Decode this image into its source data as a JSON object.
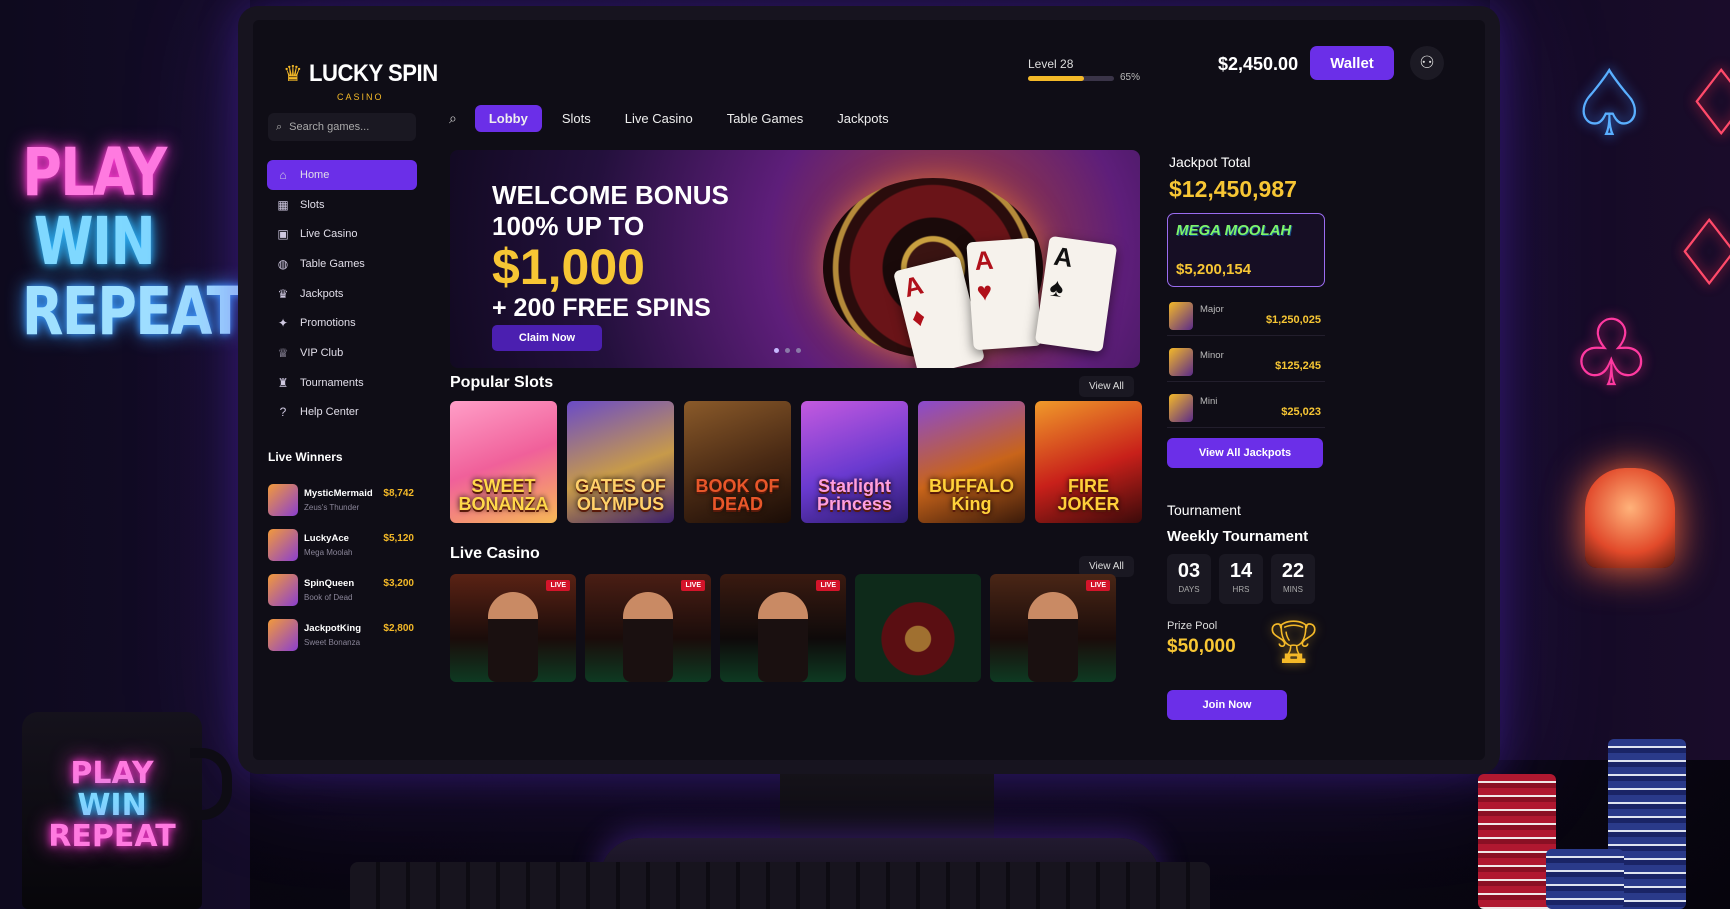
{
  "decor": {
    "neon_sign": [
      "PLAY",
      "WIN",
      "REPEAT"
    ],
    "mug_text": [
      "PLAY",
      "WIN",
      "REPEAT"
    ]
  },
  "header": {
    "logo_title": "LUCKY SPIN",
    "logo_subtitle": "CASINO",
    "level_label": "Level 28",
    "level_progress_pct": 65,
    "level_progress_text": "65%",
    "balance": "$2,450.00",
    "wallet_label": "Wallet"
  },
  "sidebar": {
    "search_placeholder": "Search games...",
    "nav": [
      {
        "label": "Home",
        "icon": "home-icon",
        "active": true
      },
      {
        "label": "Slots",
        "icon": "slots-icon"
      },
      {
        "label": "Live Casino",
        "icon": "live-casino-icon"
      },
      {
        "label": "Table Games",
        "icon": "table-games-icon"
      },
      {
        "label": "Jackpots",
        "icon": "jackpot-icon"
      },
      {
        "label": "Promotions",
        "icon": "promotions-icon"
      },
      {
        "label": "VIP Club",
        "icon": "vip-icon"
      },
      {
        "label": "Tournaments",
        "icon": "trophy-icon"
      },
      {
        "label": "Help Center",
        "icon": "help-icon"
      }
    ],
    "winners_title": "Live Winners",
    "winners": [
      {
        "name": "MysticMermaid",
        "game": "Zeus's Thunder",
        "amount": "$8,742"
      },
      {
        "name": "LuckyAce",
        "game": "Mega Moolah",
        "amount": "$5,120"
      },
      {
        "name": "SpinQueen",
        "game": "Book of Dead",
        "amount": "$3,200"
      },
      {
        "name": "JackpotKing",
        "game": "Sweet Bonanza",
        "amount": "$2,800"
      }
    ]
  },
  "tabs": [
    "Lobby",
    "Slots",
    "Live Casino",
    "Table Games",
    "Jackpots"
  ],
  "hero": {
    "line1": "WELCOME BONUS",
    "line2": "100% UP TO",
    "amount": "$1,000",
    "line3": "+ 200 FREE SPINS",
    "cta": "Claim Now",
    "cards": [
      "A",
      "A",
      "A"
    ]
  },
  "popular_slots": {
    "title": "Popular Slots",
    "view_all": "View All",
    "games": [
      {
        "name": "SWEET BONANZA",
        "bg": "linear-gradient(160deg,#ff9ec7,#f0609a 50%,#f7b955)",
        "color": "#ffd84a"
      },
      {
        "name": "GATES OF OLYMPUS",
        "bg": "linear-gradient(160deg,#6a4bc8,#c79a4a 55%,#3a1e6a)",
        "color": "#ffd16a"
      },
      {
        "name": "BOOK OF DEAD",
        "bg": "linear-gradient(160deg,#8a5a2a,#4a2a14 55%,#1a0c06)",
        "color": "#e8572a"
      },
      {
        "name": "Starlight Princess",
        "bg": "linear-gradient(160deg,#c45adf,#6a3ad0 55%,#2a1a6a)",
        "color": "#ff9fe0"
      },
      {
        "name": "BUFFALO King",
        "bg": "linear-gradient(160deg,#8a4ad0,#c8641a 55%,#3a1a0a)",
        "color": "#ffd23a"
      },
      {
        "name": "FIRE JOKER",
        "bg": "linear-gradient(160deg,#f09a2a,#c8201a 55%,#3a0a0a)",
        "color": "#ffcf3a"
      }
    ]
  },
  "live_casino": {
    "title": "Live Casino",
    "view_all": "View All",
    "tables": [
      {
        "badge": "LIVE",
        "bg": "linear-gradient(180deg,#5a2214,#1a0c0a 60%,#0e3a22)"
      },
      {
        "badge": "LIVE",
        "bg": "linear-gradient(180deg,#4a1e14,#1a0c0a 60%,#0e3a22)"
      },
      {
        "badge": "LIVE",
        "bg": "linear-gradient(180deg,#3a1a10,#0e0a0a 60%,#0e3a22)"
      },
      {
        "badge": "",
        "bg": "radial-gradient(circle at 50% 60%,#a07030 0 14%,#5a0e12 15% 40%,#0e2a1a 41%)"
      },
      {
        "badge": "LIVE",
        "bg": "linear-gradient(180deg,#4a2616,#1a0c0a 60%,#0e3a22)"
      }
    ]
  },
  "jackpots": {
    "label": "Jackpot Total",
    "total": "$12,450,987",
    "feature_name": "MEGA MOOLAH",
    "feature_amount": "$5,200,154",
    "tiers": [
      {
        "name": "Major",
        "amount": "$1,250,025"
      },
      {
        "name": "Minor",
        "amount": "$125,245"
      },
      {
        "name": "Mini",
        "amount": "$25,023"
      }
    ],
    "view_all": "View All Jackpots"
  },
  "tournament": {
    "label": "Tournament",
    "name": "Weekly Tournament",
    "countdown": [
      {
        "value": "03",
        "unit": "DAYS"
      },
      {
        "value": "14",
        "unit": "HRS"
      },
      {
        "value": "22",
        "unit": "MINS"
      }
    ],
    "prize_label": "Prize Pool",
    "prize_amount": "$50,000",
    "join": "Join Now"
  },
  "colors": {
    "accent": "#6b2fe8",
    "gold": "#f7c634",
    "live": "#d4142a"
  }
}
